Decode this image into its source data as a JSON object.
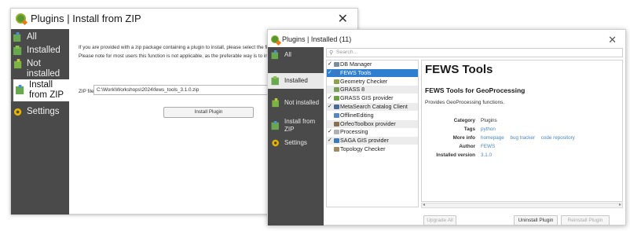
{
  "back_window": {
    "title": "Plugins | Install from ZIP",
    "sidebar": [
      {
        "label": "All",
        "icon": "puzzle-icon"
      },
      {
        "label": "Installed",
        "icon": "puzzle-installed-icon"
      },
      {
        "label": "Not installed",
        "icon": "puzzle-not-installed-icon"
      },
      {
        "label": "Install from ZIP",
        "icon": "zip-icon"
      },
      {
        "label": "Settings",
        "icon": "gear-icon"
      }
    ],
    "info_line_1": "If you are provided with a zip package containing a plugin to install, please select the file below and",
    "info_line_2": "Please note for most users this function is not applicable, as the preferable way is to install plugins f",
    "zip_label": "ZIP file",
    "zip_value": "C:\\Work\\Workshops\\2024\\fews_tools_3.1.0.zip",
    "install_button": "Install Plugin"
  },
  "front_window": {
    "title": "Plugins | Installed (11)",
    "sidebar": [
      {
        "label": "All"
      },
      {
        "label": "Installed"
      },
      {
        "label": "Not installed"
      },
      {
        "label": "Install from ZIP"
      },
      {
        "label": "Settings"
      }
    ],
    "search_placeholder": "Search...",
    "plugins": [
      {
        "name": "DB Manager",
        "checked": true,
        "color": "#7a8f9e"
      },
      {
        "name": "FEWS Tools",
        "checked": true,
        "color": "#3c78c3",
        "selected": true
      },
      {
        "name": "Geometry Checker",
        "checked": false,
        "color": "#8fa34a"
      },
      {
        "name": "GRASS 8",
        "checked": false,
        "color": "#7aa05a"
      },
      {
        "name": "GRASS GIS provider",
        "checked": true,
        "color": "#6aa040"
      },
      {
        "name": "MetaSearch Catalog Client",
        "checked": true,
        "color": "#4a6a9a"
      },
      {
        "name": "OfflineEditing",
        "checked": false,
        "color": "#5a86c0"
      },
      {
        "name": "OrfeoToolbox provider",
        "checked": false,
        "color": "#8a6e50"
      },
      {
        "name": "Processing",
        "checked": true,
        "color": "#b0b0b0"
      },
      {
        "name": "SAGA GIS provider",
        "checked": true,
        "color": "#3e7ab8"
      },
      {
        "name": "Topology Checker",
        "checked": false,
        "color": "#a08a60"
      }
    ],
    "detail": {
      "name": "FEWS Tools",
      "subtitle": "FEWS Tools for GeoProcessing",
      "description": "Provides GeoProcessing functions.",
      "category_label": "Category",
      "category": "Plugins",
      "tags_label": "Tags",
      "tags": "python",
      "more_info_label": "More info",
      "homepage": "homepage",
      "bug_tracker": "bug tracker",
      "code_repository": "code repository",
      "author_label": "Author",
      "author": "FEWS",
      "version_label": "Installed version",
      "version": "3.1.0"
    },
    "buttons": {
      "upgrade_all": "Upgrade All",
      "uninstall": "Uninstall Plugin",
      "reinstall": "Reinstall Plugin"
    }
  }
}
